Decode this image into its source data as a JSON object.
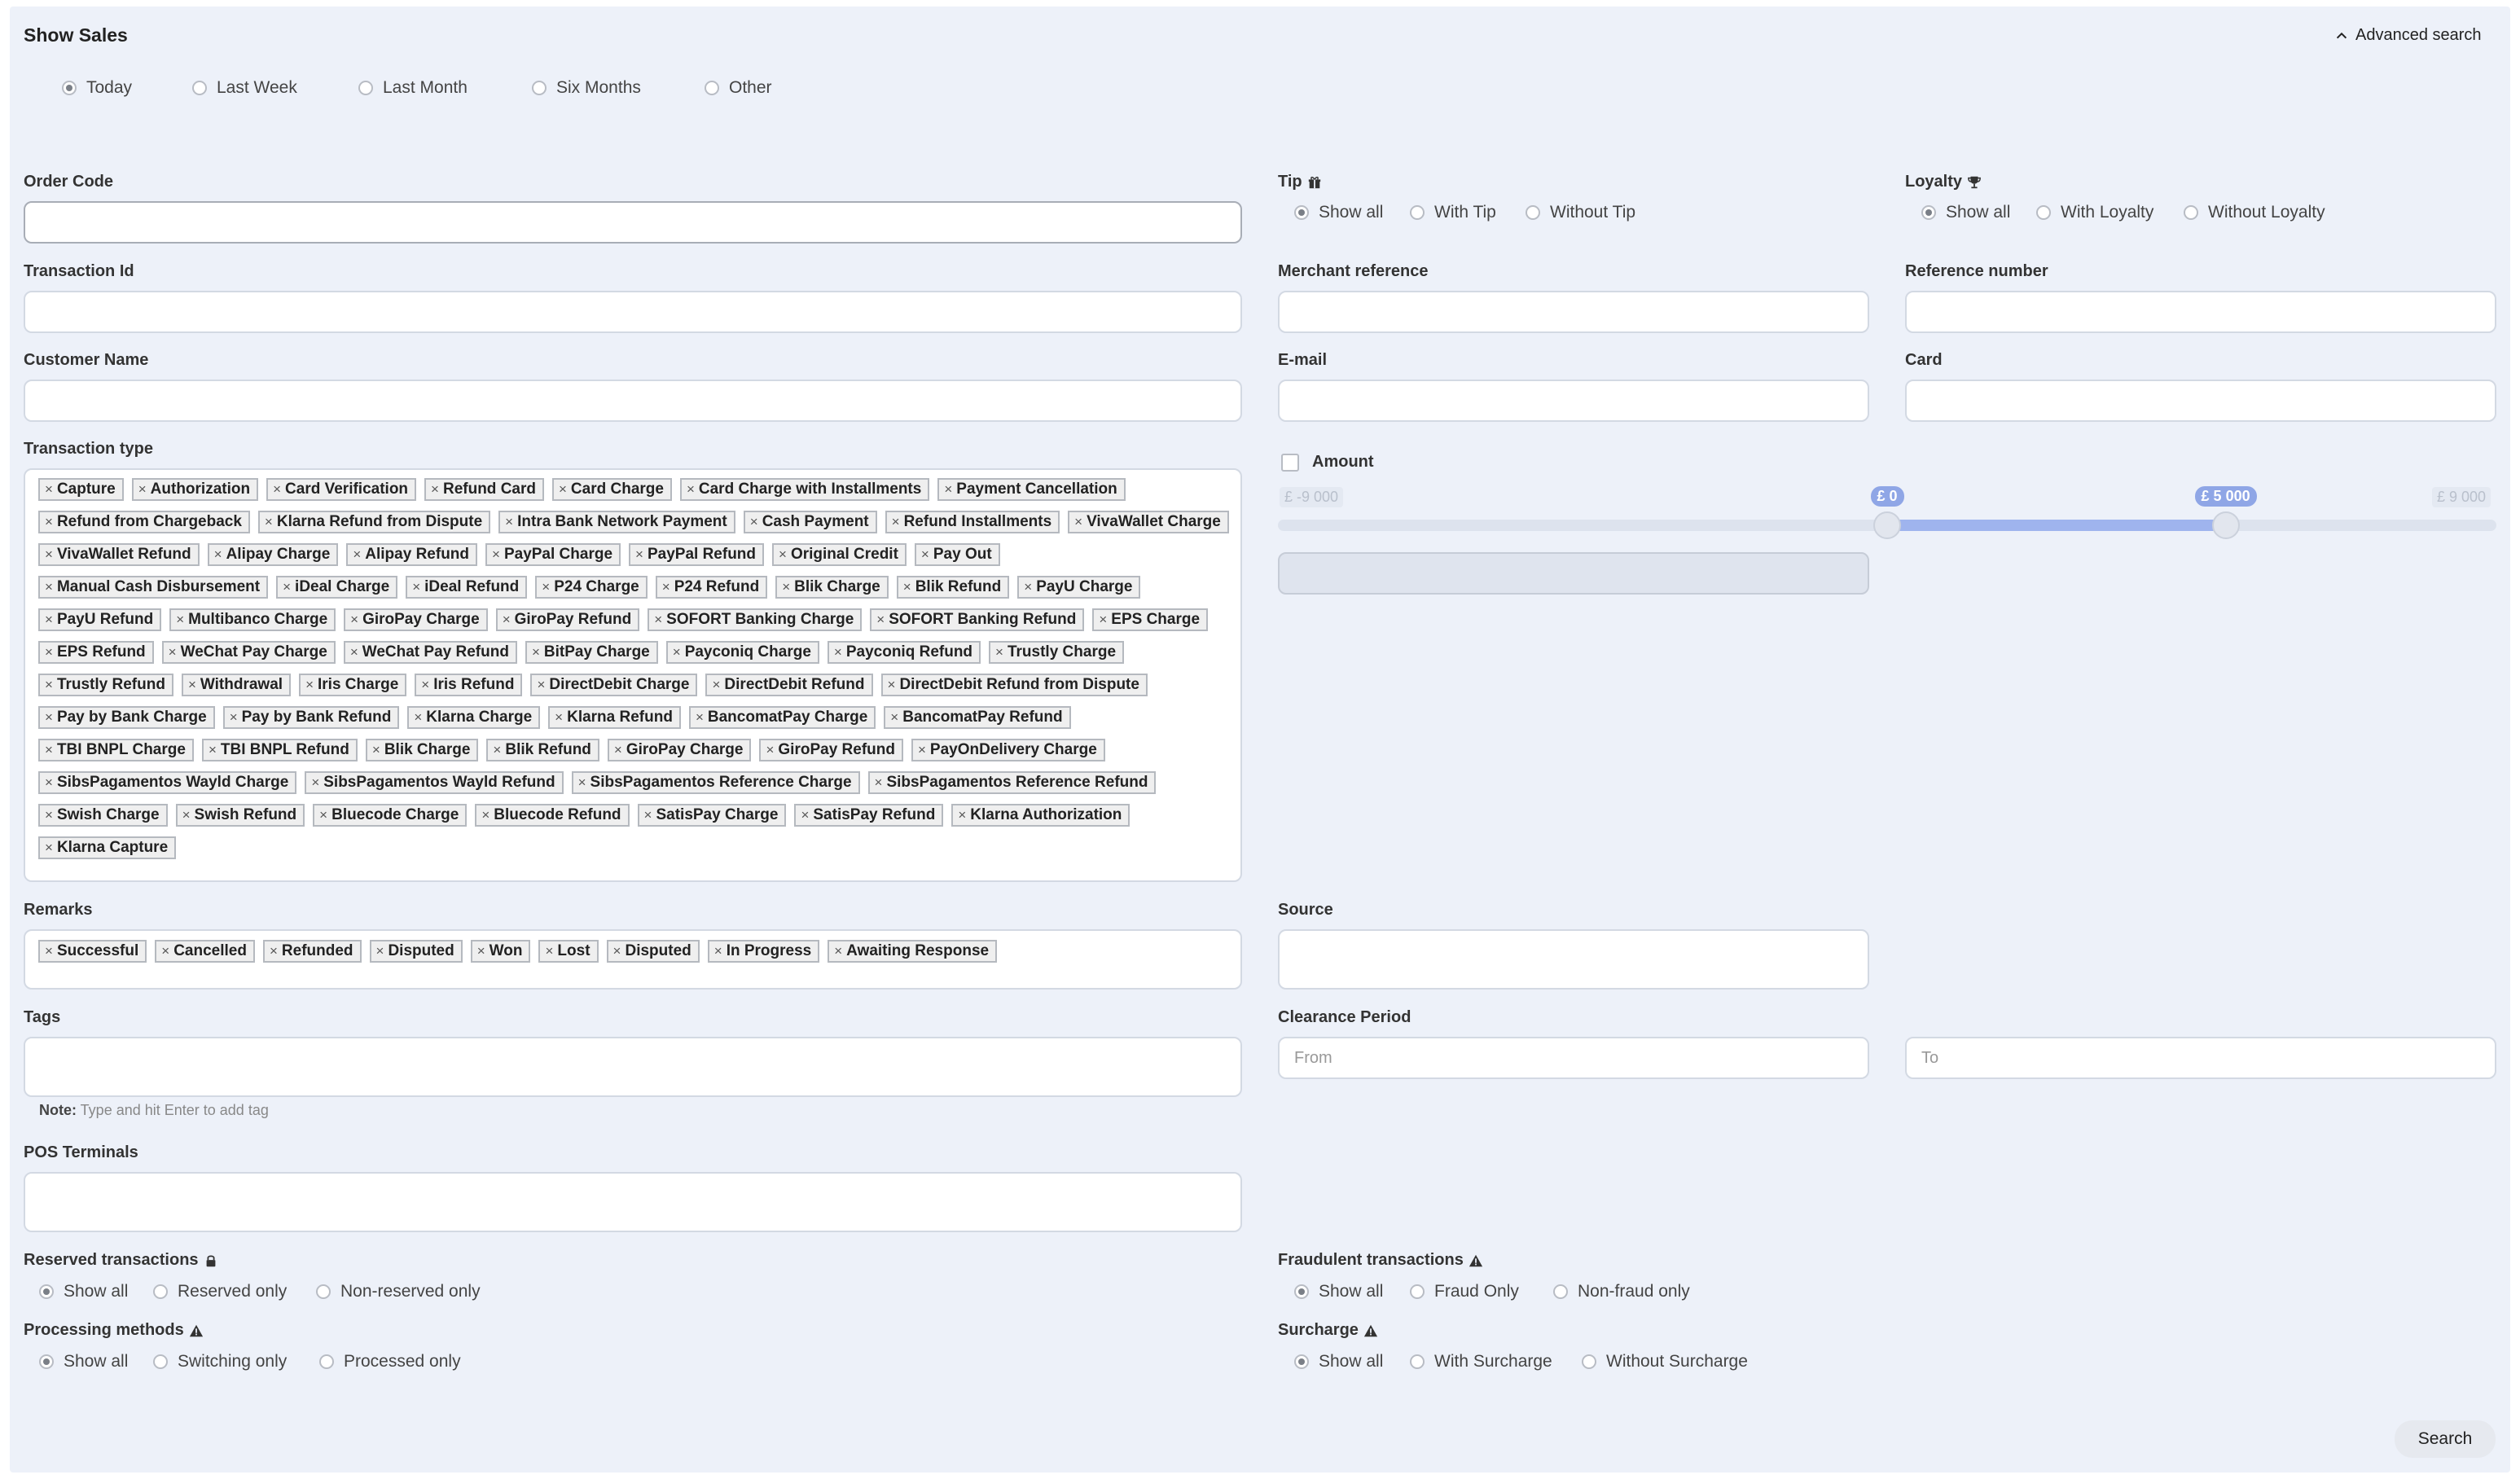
{
  "header": {
    "title": "Show Sales",
    "advanced_search": "Advanced search"
  },
  "period": {
    "options": [
      "Today",
      "Last Week",
      "Last Month",
      "Six Months",
      "Other"
    ],
    "selected": "Today"
  },
  "fields": {
    "order_code": "Order Code",
    "transaction_id": "Transaction Id",
    "customer_name": "Customer Name",
    "merchant_reference": "Merchant reference",
    "reference_number": "Reference number",
    "email": "E-mail",
    "card": "Card",
    "source": "Source",
    "tags": "Tags",
    "pos_terminals": "POS Terminals"
  },
  "tip": {
    "label": "Tip",
    "icon": "gift-icon",
    "options": [
      "Show all",
      "With Tip",
      "Without Tip"
    ],
    "selected": "Show all"
  },
  "loyalty": {
    "label": "Loyalty",
    "icon": "trophy-icon",
    "options": [
      "Show all",
      "With Loyalty",
      "Without Loyalty"
    ],
    "selected": "Show all"
  },
  "transaction_type": {
    "label": "Transaction type",
    "tags": [
      "Capture",
      "Authorization",
      "Card Verification",
      "Refund Card",
      "Card Charge",
      "Card Charge with Installments",
      "Payment Cancellation",
      "Refund from Chargeback",
      "Klarna Refund from Dispute",
      "Intra Bank Network Payment",
      "Cash Payment",
      "Refund Installments",
      "VivaWallet Charge",
      "VivaWallet Refund",
      "Alipay Charge",
      "Alipay Refund",
      "PayPal Charge",
      "PayPal Refund",
      "Original Credit",
      "Pay Out",
      "Manual Cash Disbursement",
      "iDeal Charge",
      "iDeal Refund",
      "P24 Charge",
      "P24 Refund",
      "Blik Charge",
      "Blik Refund",
      "PayU Charge",
      "PayU Refund",
      "Multibanco Charge",
      "GiroPay Charge",
      "GiroPay Refund",
      "SOFORT Banking Charge",
      "SOFORT Banking Refund",
      "EPS Charge",
      "EPS Refund",
      "WeChat Pay Charge",
      "WeChat Pay Refund",
      "BitPay Charge",
      "Payconiq Charge",
      "Payconiq Refund",
      "Trustly Charge",
      "Trustly Refund",
      "Withdrawal",
      "Iris Charge",
      "Iris Refund",
      "DirectDebit Charge",
      "DirectDebit Refund",
      "DirectDebit Refund from Dispute",
      "Pay by Bank Charge",
      "Pay by Bank Refund",
      "Klarna Charge",
      "Klarna Refund",
      "BancomatPay Charge",
      "BancomatPay Refund",
      "TBI BNPL Charge",
      "TBI BNPL Refund",
      "Blik Charge",
      "Blik Refund",
      "GiroPay Charge",
      "GiroPay Refund",
      "PayOnDelivery Charge",
      "SibsPagamentos Wayld Charge",
      "SibsPagamentos Wayld Refund",
      "SibsPagamentos Reference Charge",
      "SibsPagamentos Reference Refund",
      "Swish Charge",
      "Swish Refund",
      "Bluecode Charge",
      "Bluecode Refund",
      "SatisPay Charge",
      "SatisPay Refund",
      "Klarna Authorization",
      "Klarna Capture"
    ]
  },
  "amount": {
    "label": "Amount",
    "min_label": "£ -9 000",
    "max_label": "£ 9 000",
    "low_label": "£ 0",
    "high_label": "£ 5 000",
    "min": -9000,
    "max": 9000,
    "low": 0,
    "high": 5000,
    "checked": false
  },
  "remarks": {
    "label": "Remarks",
    "tags": [
      "Successful",
      "Cancelled",
      "Refunded",
      "Disputed",
      "Won",
      "Lost",
      "Disputed",
      "In Progress",
      "Awaiting Response"
    ]
  },
  "tags_note": {
    "prefix": "Note:",
    "text": " Type and hit Enter to add tag"
  },
  "clearance": {
    "label": "Clearance Period",
    "from_placeholder": "From",
    "to_placeholder": "To"
  },
  "reserved": {
    "label": "Reserved transactions",
    "icon": "lock-icon",
    "options": [
      "Show all",
      "Reserved only",
      "Non-reserved only"
    ],
    "selected": "Show all"
  },
  "fraudulent": {
    "label": "Fraudulent transactions",
    "icon": "warning-icon",
    "options": [
      "Show all",
      "Fraud Only",
      "Non-fraud only"
    ],
    "selected": "Show all"
  },
  "processing": {
    "label": "Processing methods",
    "icon": "warning-icon",
    "options": [
      "Show all",
      "Switching only",
      "Processed only"
    ],
    "selected": "Show all"
  },
  "surcharge": {
    "label": "Surcharge",
    "icon": "warning-icon",
    "options": [
      "Show all",
      "With Surcharge",
      "Without Surcharge"
    ],
    "selected": "Show all"
  },
  "search_button": "Search"
}
